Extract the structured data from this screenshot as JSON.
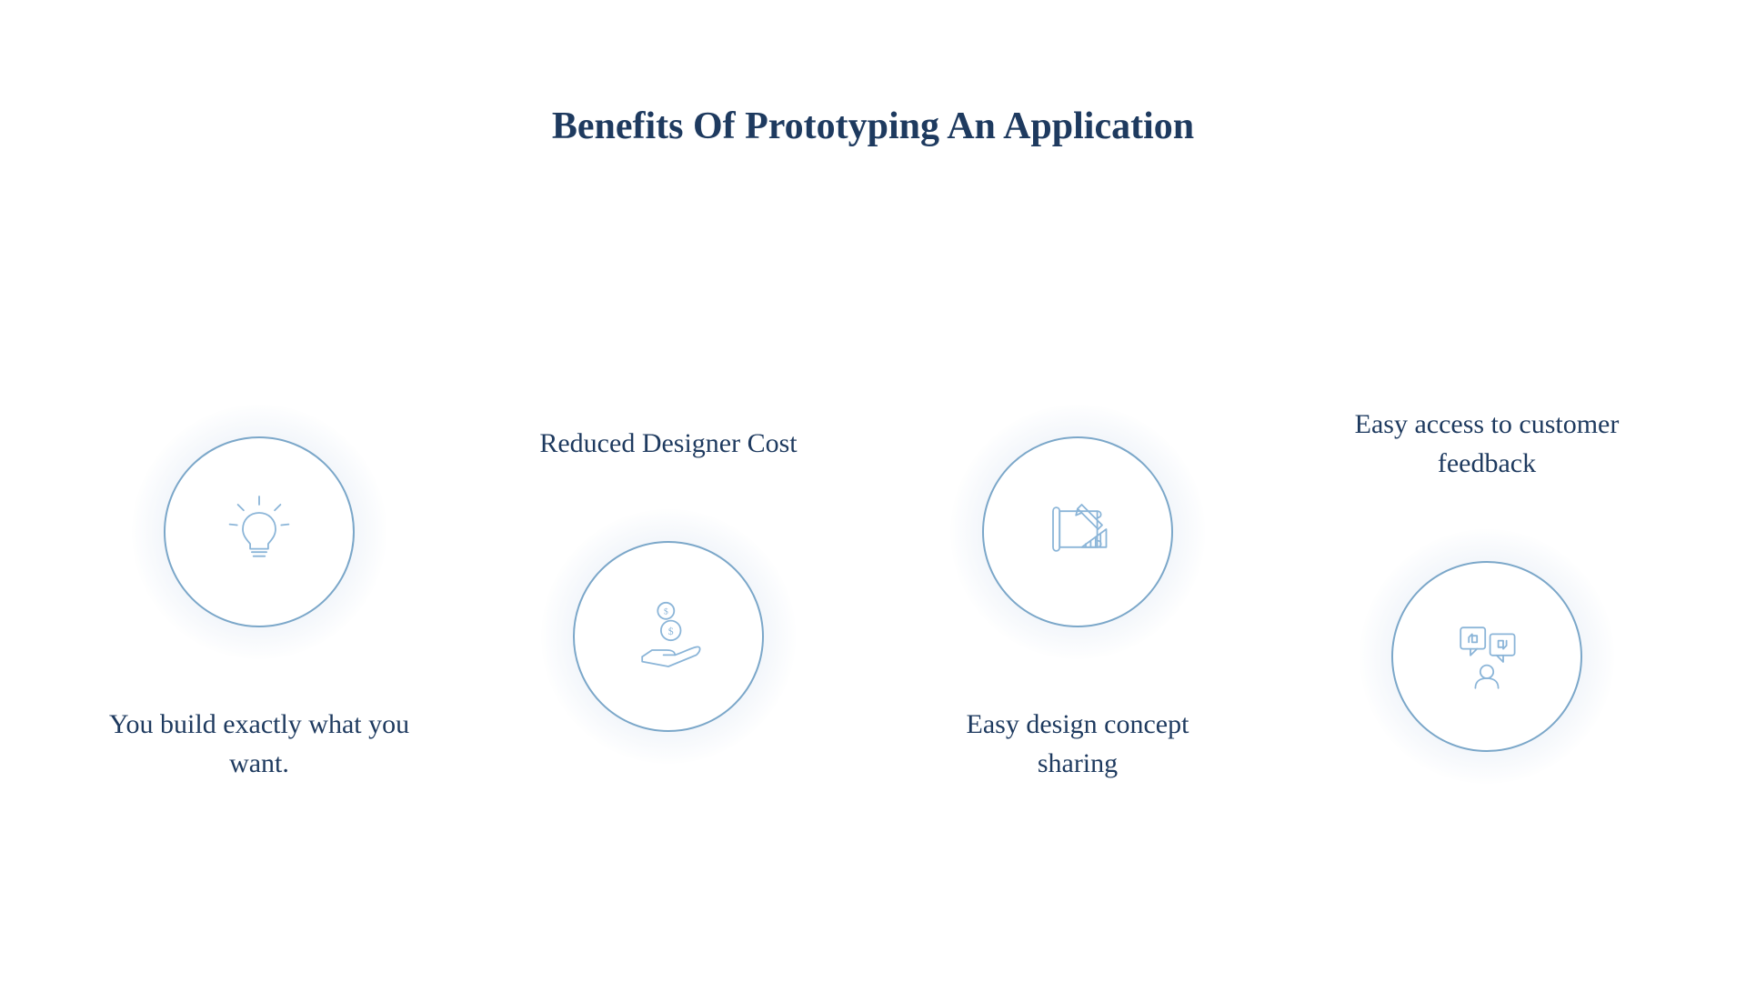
{
  "title": "Benefits Of Prototyping An Application",
  "benefits": [
    {
      "icon": "lightbulb-icon",
      "text": "You build exactly what you want.",
      "position": "icon-top"
    },
    {
      "icon": "money-hand-icon",
      "text": "Reduced Designer Cost",
      "position": "icon-bottom"
    },
    {
      "icon": "blueprint-icon",
      "text": "Easy design concept sharing",
      "position": "icon-top"
    },
    {
      "icon": "feedback-icon",
      "text": "Easy access to customer feedback",
      "position": "icon-bottom"
    }
  ],
  "colors": {
    "primary_text": "#1e3a5f",
    "icon_stroke": "#8bb5d8",
    "circle_border": "#7ba7c9"
  }
}
